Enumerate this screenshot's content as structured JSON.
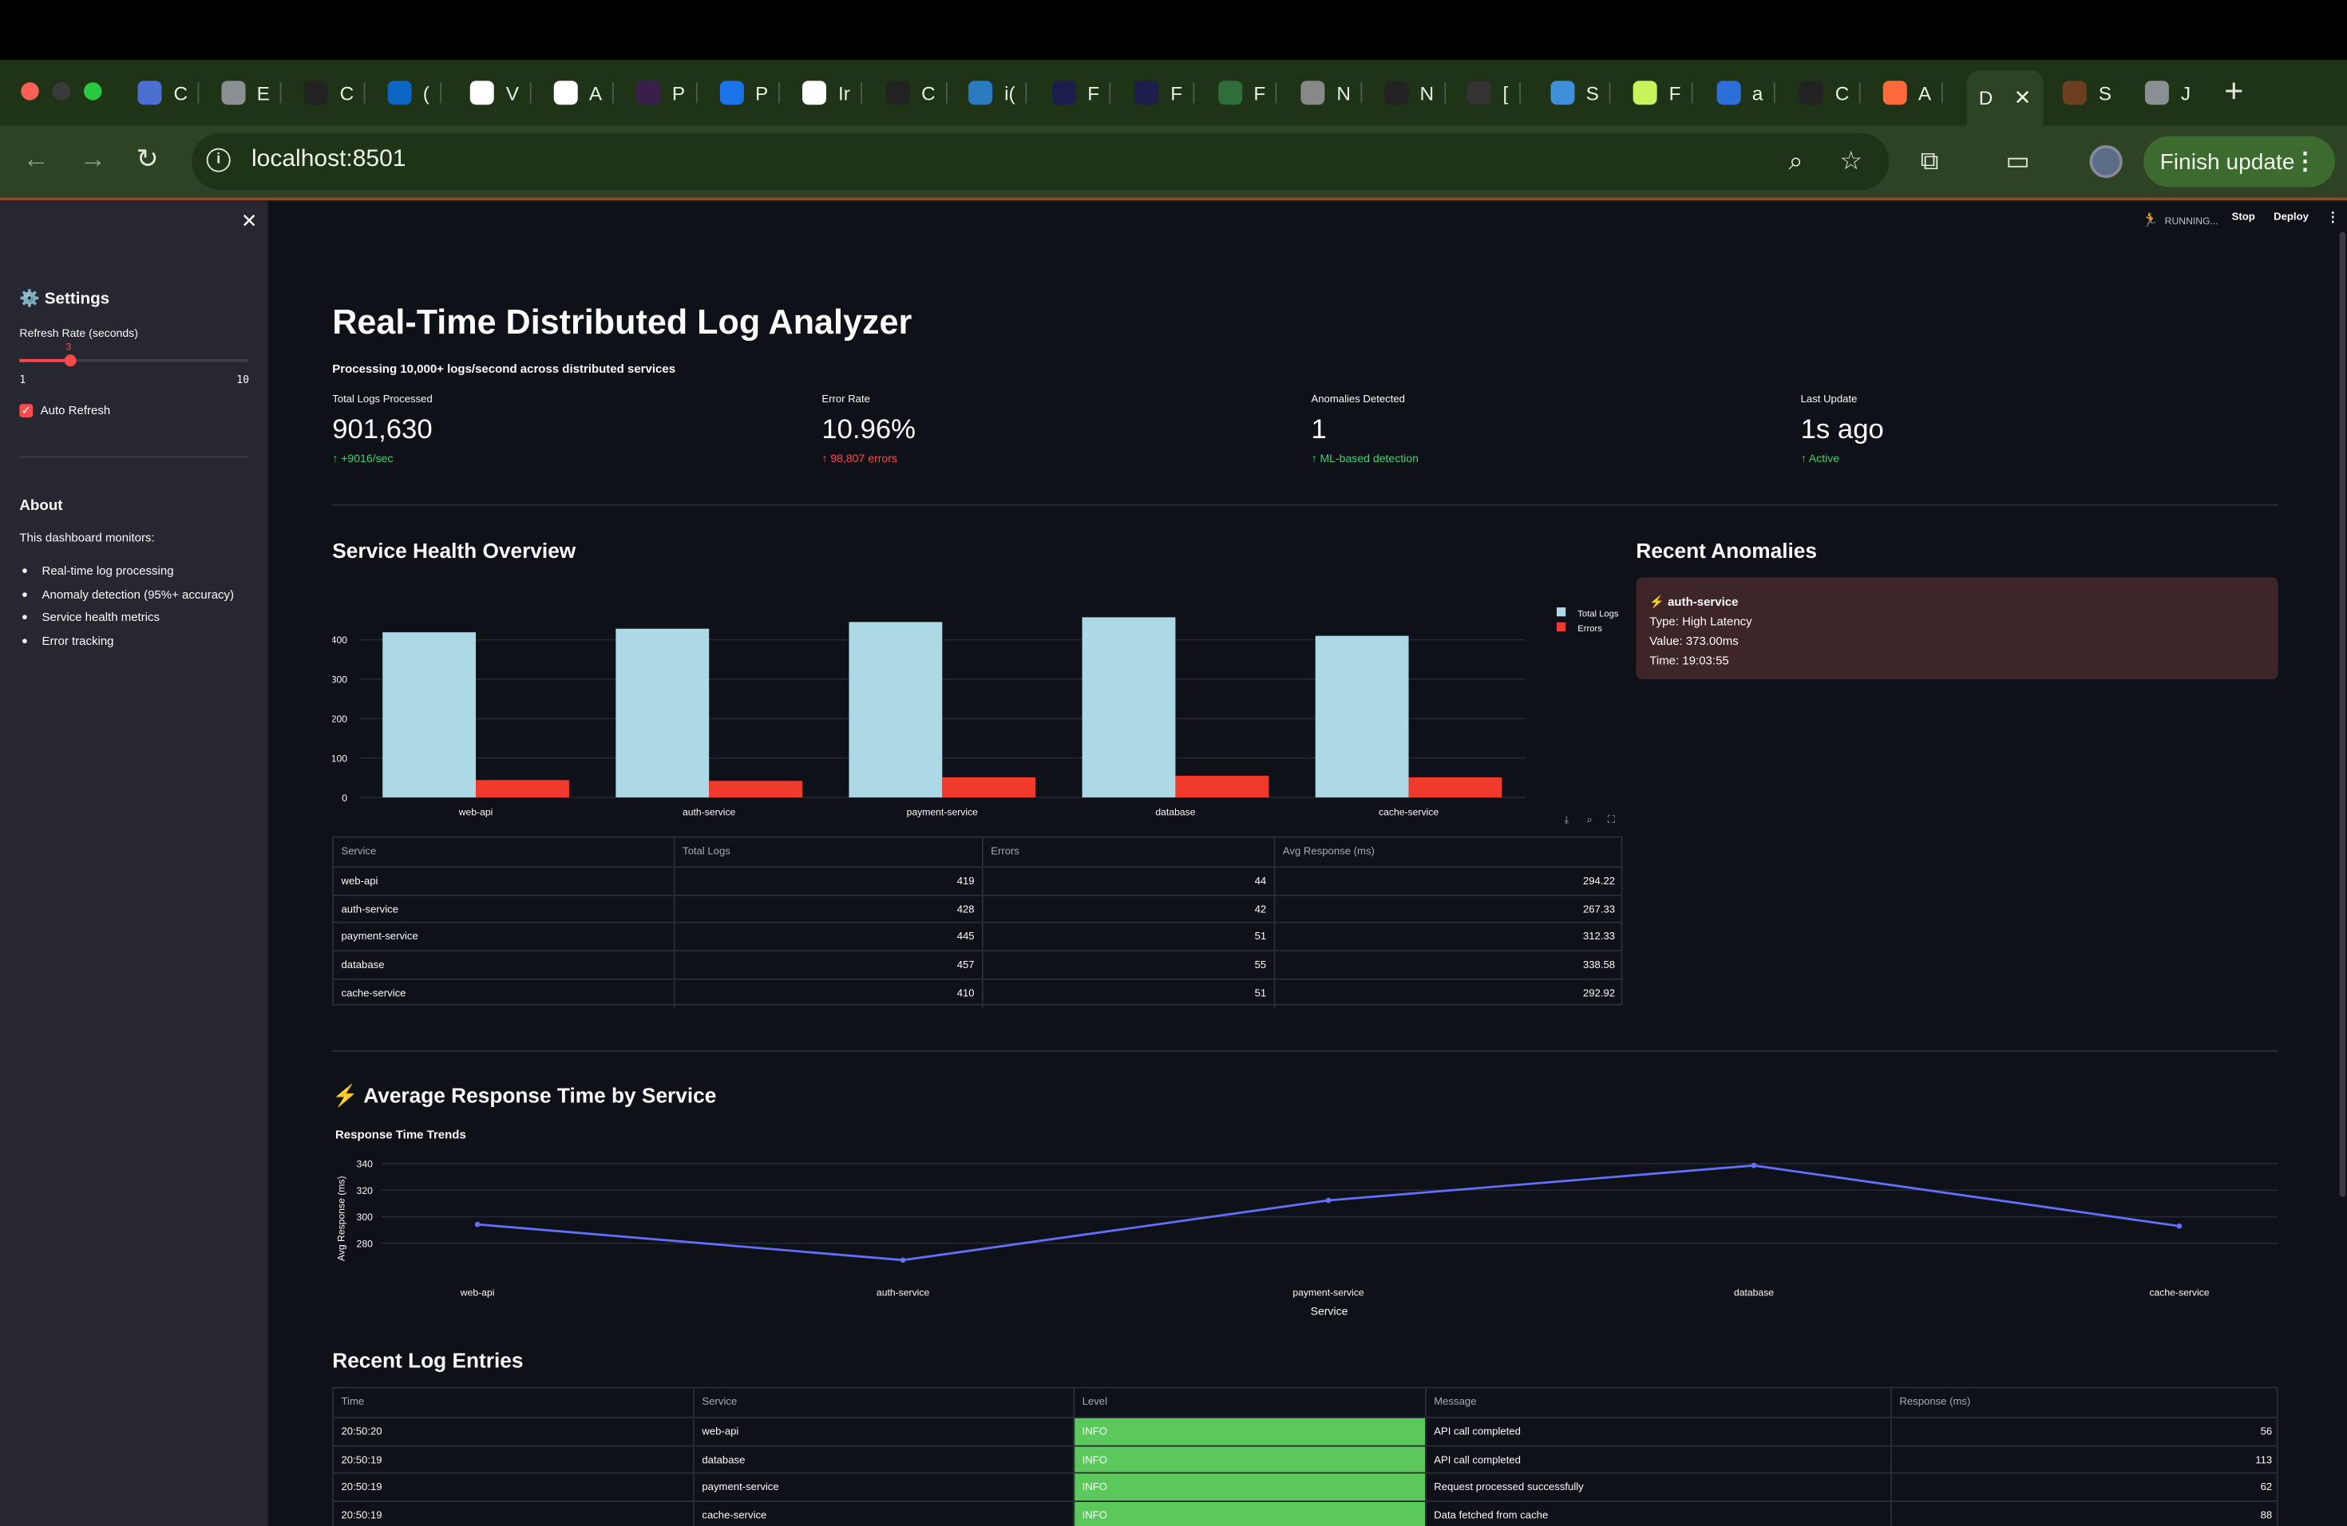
{
  "browser": {
    "tabs": [
      {
        "letter": "C",
        "icon": "shield-icon",
        "color": "#4b6ed1"
      },
      {
        "letter": "E",
        "icon": "globe-icon",
        "color": "#8a8f94"
      },
      {
        "letter": "C",
        "icon": "github-icon",
        "color": "#222"
      },
      {
        "letter": "(",
        "icon": "linkedin-icon",
        "color": "#0a66c2"
      },
      {
        "letter": "V",
        "icon": "google-icon",
        "color": "#fff"
      },
      {
        "letter": "A",
        "icon": "google-icon",
        "color": "#fff"
      },
      {
        "letter": "P",
        "icon": "app-icon",
        "color": "#3a1f4a"
      },
      {
        "letter": "P",
        "icon": "play-icon",
        "color": "#1a73e8"
      },
      {
        "letter": "Ir",
        "icon": "gmail-icon",
        "color": "#fff"
      },
      {
        "letter": "C",
        "icon": "github-icon",
        "color": "#222"
      },
      {
        "letter": "i(",
        "icon": "app-icon",
        "color": "#2a7bbf"
      },
      {
        "letter": "F",
        "icon": "r-icon",
        "color": "#1c1d4c"
      },
      {
        "letter": "F",
        "icon": "r-icon",
        "color": "#1c1d4c"
      },
      {
        "letter": "F",
        "icon": "bolt-icon",
        "color": "#2f6e3a"
      },
      {
        "letter": "N",
        "icon": "chrome-icon",
        "color": "#888"
      },
      {
        "letter": "N",
        "icon": "github-icon",
        "color": "#222"
      },
      {
        "letter": "[",
        "icon": "github-icon",
        "color": "#333"
      },
      {
        "letter": "S",
        "icon": "stack-icon",
        "color": "#3f8fd8"
      },
      {
        "letter": "F",
        "icon": "pen-icon",
        "color": "#c8f35b"
      },
      {
        "letter": "a",
        "icon": "docker-icon",
        "color": "#2c6fd8"
      },
      {
        "letter": "C",
        "icon": "github-icon",
        "color": "#222"
      },
      {
        "letter": "A",
        "icon": "star-icon",
        "color": "#ff6a3d"
      }
    ],
    "active_tab": "D",
    "after_tabs": [
      {
        "letter": "S",
        "icon": "app-icon",
        "color": "#6b3f1f"
      },
      {
        "letter": "J",
        "icon": "globe-icon",
        "color": "#8a8f94"
      }
    ],
    "url": "localhost:8501",
    "finish_update": "Finish update"
  },
  "sidebar": {
    "settings_title": "⚙️ Settings",
    "refresh_label": "Refresh Rate (seconds)",
    "slider": {
      "value": "3",
      "min": "1",
      "max": "10",
      "fraction": 0.222
    },
    "auto_refresh": "Auto Refresh",
    "about_title": "About",
    "about_text": "This dashboard monitors:",
    "about_items": [
      "Real-time log processing",
      "Anomaly detection (95%+ accuracy)",
      "Service health metrics",
      "Error tracking"
    ]
  },
  "toolbar": {
    "status": "RUNNING...",
    "stop": "Stop",
    "deploy": "Deploy"
  },
  "main": {
    "title": "Real-Time Distributed Log Analyzer",
    "subtitle": "Processing 10,000+ logs/second across distributed services",
    "metrics": [
      {
        "label": "Total Logs Processed",
        "value": "901,630",
        "delta": "↑ +9016/sec",
        "delta_color": "green"
      },
      {
        "label": "Error Rate",
        "value": "10.96%",
        "delta": "↑ 98,807 errors",
        "delta_color": "red"
      },
      {
        "label": "Anomalies Detected",
        "value": "1",
        "delta": "↑ ML-based detection",
        "delta_color": "green"
      },
      {
        "label": "Last Update",
        "value": "1s ago",
        "delta": "↑ Active",
        "delta_color": "green"
      }
    ],
    "health_title": "Service Health Overview",
    "anomalies_title": "Recent Anomalies",
    "anomaly": {
      "service": "⚡ auth-service",
      "type": "Type: High Latency",
      "value": "Value: 373.00ms",
      "time": "Time: 19:03:55"
    },
    "service_table": {
      "headers": [
        "Service",
        "Total Logs",
        "Errors",
        "Avg Response (ms)"
      ],
      "rows": [
        [
          "web-api",
          "419",
          "44",
          "294.22"
        ],
        [
          "auth-service",
          "428",
          "42",
          "267.33"
        ],
        [
          "payment-service",
          "445",
          "51",
          "312.33"
        ],
        [
          "database",
          "457",
          "55",
          "338.58"
        ],
        [
          "cache-service",
          "410",
          "51",
          "292.92"
        ]
      ]
    },
    "response_title": "⚡ Average Response Time by Service",
    "log_title": "Recent Log Entries",
    "log_table": {
      "headers": [
        "Time",
        "Service",
        "Level",
        "Message",
        "Response (ms)"
      ],
      "rows": [
        [
          "20:50:20",
          "web-api",
          "INFO",
          "API call completed",
          "56"
        ],
        [
          "20:50:19",
          "database",
          "INFO",
          "API call completed",
          "113"
        ],
        [
          "20:50:19",
          "payment-service",
          "INFO",
          "Request processed successfully",
          "62"
        ],
        [
          "20:50:19",
          "cache-service",
          "INFO",
          "Data fetched from cache",
          "88"
        ]
      ]
    }
  },
  "chart_data": [
    {
      "type": "bar",
      "categories": [
        "web-api",
        "auth-service",
        "payment-service",
        "database",
        "cache-service"
      ],
      "series": [
        {
          "name": "Total Logs",
          "values": [
            419,
            428,
            445,
            457,
            410
          ],
          "color": "#add8e6"
        },
        {
          "name": "Errors",
          "values": [
            44,
            42,
            51,
            55,
            51
          ],
          "color": "#ef3a2c"
        }
      ],
      "yticks": [
        "0",
        "100",
        "200",
        "300",
        "400"
      ],
      "ylim": [
        0,
        520
      ],
      "legend": "top-right",
      "grid": true
    },
    {
      "type": "line",
      "title": "Response Time Trends",
      "xlabel": "Service",
      "ylabel": "Avg Response (ms)",
      "categories": [
        "web-api",
        "auth-service",
        "payment-service",
        "database",
        "cache-service"
      ],
      "values": [
        294.22,
        267.33,
        312.33,
        338.58,
        292.92
      ],
      "yticks": [
        "280",
        "300",
        "320",
        "340"
      ],
      "ylim": [
        262,
        342
      ],
      "color": "#636efa",
      "grid": true
    }
  ]
}
